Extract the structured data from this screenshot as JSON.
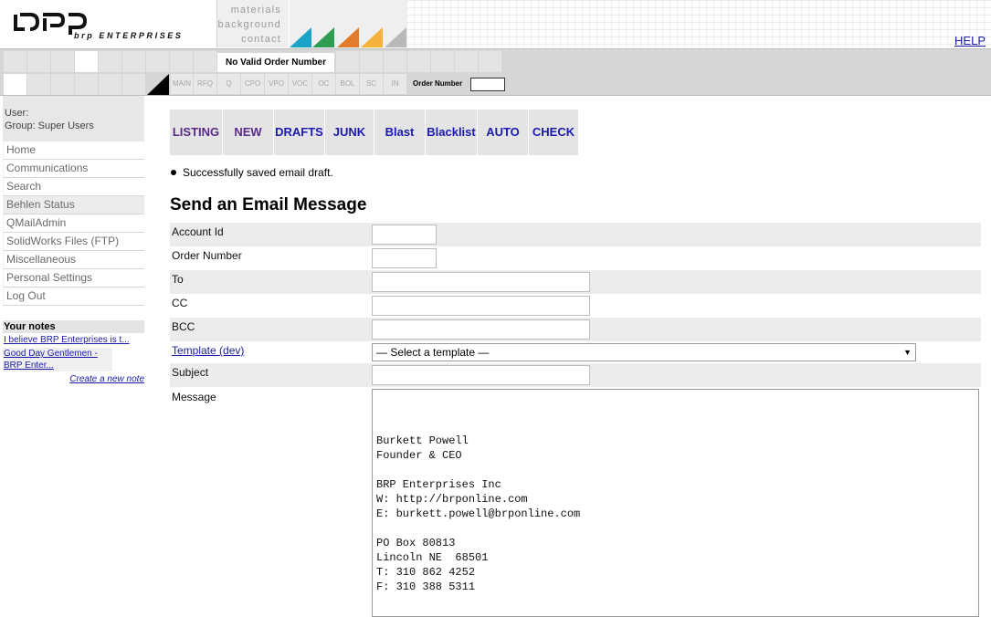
{
  "header": {
    "brand": {
      "mark": "bpp",
      "subtitle": "brp ENTERPRISES"
    },
    "top_links": [
      "materials",
      "background",
      "contact"
    ],
    "triangle_colors": [
      "#1aa3c7",
      "#2f9e53",
      "#e27b2c",
      "#f5b23b",
      "#b9b9b9"
    ],
    "help_label": "HELP"
  },
  "nav": {
    "order_status": "No Valid Order Number",
    "tabs": [
      "MAIN",
      "RFQ",
      "Q",
      "CPO",
      "VPO",
      "VOC",
      "OC",
      "BOL",
      "SC",
      "IN"
    ],
    "order_number_label": "Order Number",
    "order_number_value": ""
  },
  "sidebar": {
    "user_label": "User:",
    "group_label": "Group: Super Users",
    "menu": [
      "Home",
      "Communications",
      "Search",
      "Behlen Status",
      "QMailAdmin",
      "SolidWorks Files (FTP)",
      "Miscellaneous",
      "Personal Settings",
      "Log Out"
    ],
    "notes_title": "Your notes",
    "notes": [
      "I believe BRP Enterprises is t...",
      "Good Day Gentlemen - BRP Enter..."
    ],
    "create_note_label": "Create a new note"
  },
  "main": {
    "tabs": [
      {
        "label": "LISTING",
        "color": "purple"
      },
      {
        "label": "NEW",
        "color": "purple"
      },
      {
        "label": "DRAFTS",
        "color": "blue"
      },
      {
        "label": "JUNK",
        "color": "blue"
      },
      {
        "label": "Blast",
        "color": "blue"
      },
      {
        "label": "Blacklist",
        "color": "blue"
      },
      {
        "label": "AUTO",
        "color": "blue"
      },
      {
        "label": "CHECK",
        "color": "blue"
      }
    ],
    "success_message": "Successfully saved email draft.",
    "page_title": "Send an Email Message",
    "form": {
      "account_id_label": "Account Id",
      "account_id_value": "",
      "order_number_label": "Order Number",
      "order_number_value": "",
      "to_label": "To",
      "to_value": "",
      "cc_label": "CC",
      "cc_value": "",
      "bcc_label": "BCC",
      "bcc_value": "",
      "template_label": "Template (dev)",
      "template_selected": "— Select a template —",
      "subject_label": "Subject",
      "subject_value": "",
      "message_label": "Message",
      "message_lines": [
        "Burkett Powell",
        "Founder & CEO",
        "",
        "BRP Enterprises Inc",
        "W: http://brponline.com",
        "E: burkett.powell@brponline.com",
        "",
        "PO Box 80813",
        "Lincoln NE  68501",
        "T: 310 862 4252",
        "F: 310 388 5311"
      ]
    }
  }
}
